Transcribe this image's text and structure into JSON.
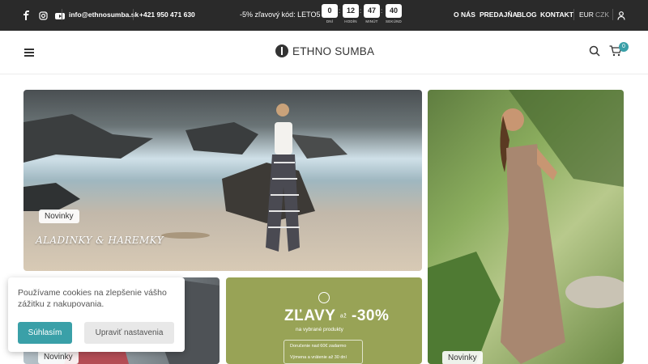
{
  "topbar": {
    "social_icons": [
      "facebook-icon",
      "instagram-icon",
      "youtube-icon"
    ],
    "email": "info@ethnosumba.sk",
    "phone": "+421 950 471 630",
    "promo": "-5% zľavový kód: LETO5",
    "countdown": [
      {
        "value": "0",
        "label": "DNÍ"
      },
      {
        "value": "12",
        "label": "HODÍN"
      },
      {
        "value": "47",
        "label": "MINÚT"
      },
      {
        "value": "40",
        "label": "SEKÚND"
      }
    ],
    "nav": [
      "O NÁS",
      "PREDAJŇA",
      "BLOG",
      "KONTAKT"
    ],
    "currency": {
      "active": "EUR",
      "inactive": "CZK"
    }
  },
  "header": {
    "logo_text": "ETHNO SUMBA",
    "cart_count": "0"
  },
  "banners": {
    "main_badge": "Novinky",
    "main_script": "ALADINKY & HAREMKY",
    "right_badge": "Novinky",
    "small_badge": "Novinky",
    "sale": {
      "title": "ZĽAVY",
      "title_prefix": "až",
      "title_value": "-30%",
      "subtitle": "na vybrané produkty",
      "line1": "Doručenie nad 60€ zadarmo",
      "line2": "Výmena a vrátenie až 30 dní"
    }
  },
  "cookie": {
    "text": "Používame cookies na zlepšenie vášho zážitku z nakupovania.",
    "accept_label": "Súhlasím",
    "settings_label": "Upraviť nastavenia"
  },
  "colors": {
    "topbar_bg": "#2a2a2a",
    "accent": "#3aa0a8",
    "sale_bg": "#98a356"
  }
}
